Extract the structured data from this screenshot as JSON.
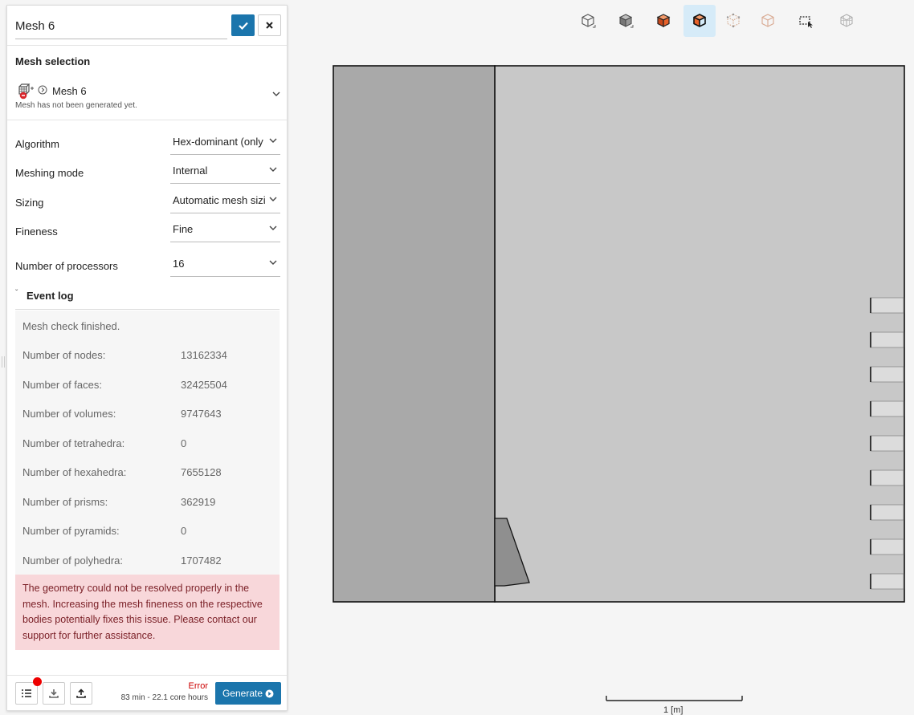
{
  "panel": {
    "title": "Mesh 6",
    "mesh_selection": {
      "heading": "Mesh selection",
      "name": "Mesh 6",
      "status": "Mesh has not been generated yet."
    },
    "properties": [
      {
        "label": "Algorithm",
        "value": "Hex-dominant (only"
      },
      {
        "label": "Meshing mode",
        "value": "Internal"
      },
      {
        "label": "Sizing",
        "value": "Automatic mesh sizi"
      },
      {
        "label": "Fineness",
        "value": "Fine"
      },
      {
        "label": "Number of processors",
        "value": "16"
      }
    ],
    "event_log": {
      "heading": "Event log",
      "first_line": "Mesh check finished.",
      "rows": [
        {
          "key": "Number of nodes:",
          "value": "13162334"
        },
        {
          "key": "Number of faces:",
          "value": "32425504"
        },
        {
          "key": "Number of volumes:",
          "value": "9747643"
        },
        {
          "key": "Number of tetrahedra:",
          "value": "0"
        },
        {
          "key": "Number of hexahedra:",
          "value": "7655128"
        },
        {
          "key": "Number of prisms:",
          "value": "362919"
        },
        {
          "key": "Number of pyramids:",
          "value": "0"
        },
        {
          "key": "Number of polyhedra:",
          "value": "1707482"
        }
      ],
      "error": "The geometry could not be resolved properly in the mesh. Increasing the mesh fineness on the respective bodies potentially fixes this issue. Please contact our support for further assistance."
    },
    "footer": {
      "status": "Error",
      "cost": "83 min - 22.1 core hours",
      "generate_label": "Generate"
    }
  },
  "viewer": {
    "toolbar": [
      "box-outline-icon",
      "box-solid-icon",
      "box-orange-icon",
      "box-edges-icon",
      "box-points-icon",
      "box-faded-icon",
      "box-select-icon",
      "box-grid-icon"
    ],
    "active_tool": "box-edges-icon",
    "scale_label": "1 [m]"
  },
  "colors": {
    "accent": "#1b75ac",
    "error_bg": "#f8d7da",
    "error_text": "#7a1f26",
    "geometry_fill": "#c8c8c8",
    "geometry_dark": "#a9a9a9",
    "orange": "#e8622a"
  }
}
